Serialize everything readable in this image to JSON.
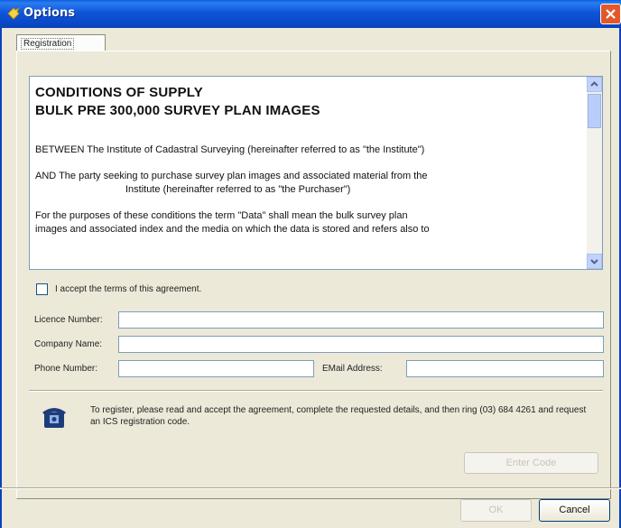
{
  "window": {
    "title": "Options",
    "app_icon": "options-icon",
    "close_icon": "close-icon"
  },
  "tabs": [
    {
      "label": "Registration"
    }
  ],
  "agreement": {
    "heading_line1": "CONDITIONS OF SUPPLY",
    "heading_line2": "BULK PRE 300,000 SURVEY PLAN IMAGES",
    "between": "BETWEEN   The Institute of Cadastral Surveying (hereinafter referred to as \"the Institute\")",
    "and_line1": "AND  The party seeking to purchase survey plan images and associated material from the",
    "and_line2": "Institute (hereinafter referred to as \"the Purchaser\")",
    "purposes_line1": "For the purposes of these conditions the term \"Data\" shall mean the bulk survey plan",
    "purposes_line2": "images and associated index and the media on which the data is stored and refers also to"
  },
  "accept": {
    "label": "I accept the terms of this agreement.",
    "checked": false
  },
  "form": {
    "licence_label": "Licence Number:",
    "licence_value": "",
    "company_label": "Company Name:",
    "company_value": "",
    "phone_label": "Phone Number:",
    "phone_value": "",
    "email_label": "EMail Address:",
    "email_value": ""
  },
  "info": {
    "icon": "telephone-icon",
    "text": "To register, please read and accept the agreement, complete the requested details, and then ring (03) 684 4261 and request an ICS registration code."
  },
  "buttons": {
    "enter_code": "Enter Code",
    "ok": "OK",
    "cancel": "Cancel"
  },
  "colors": {
    "titlebar": "#0a4fd0",
    "close_button": "#e2582a",
    "face": "#ece9d8"
  }
}
